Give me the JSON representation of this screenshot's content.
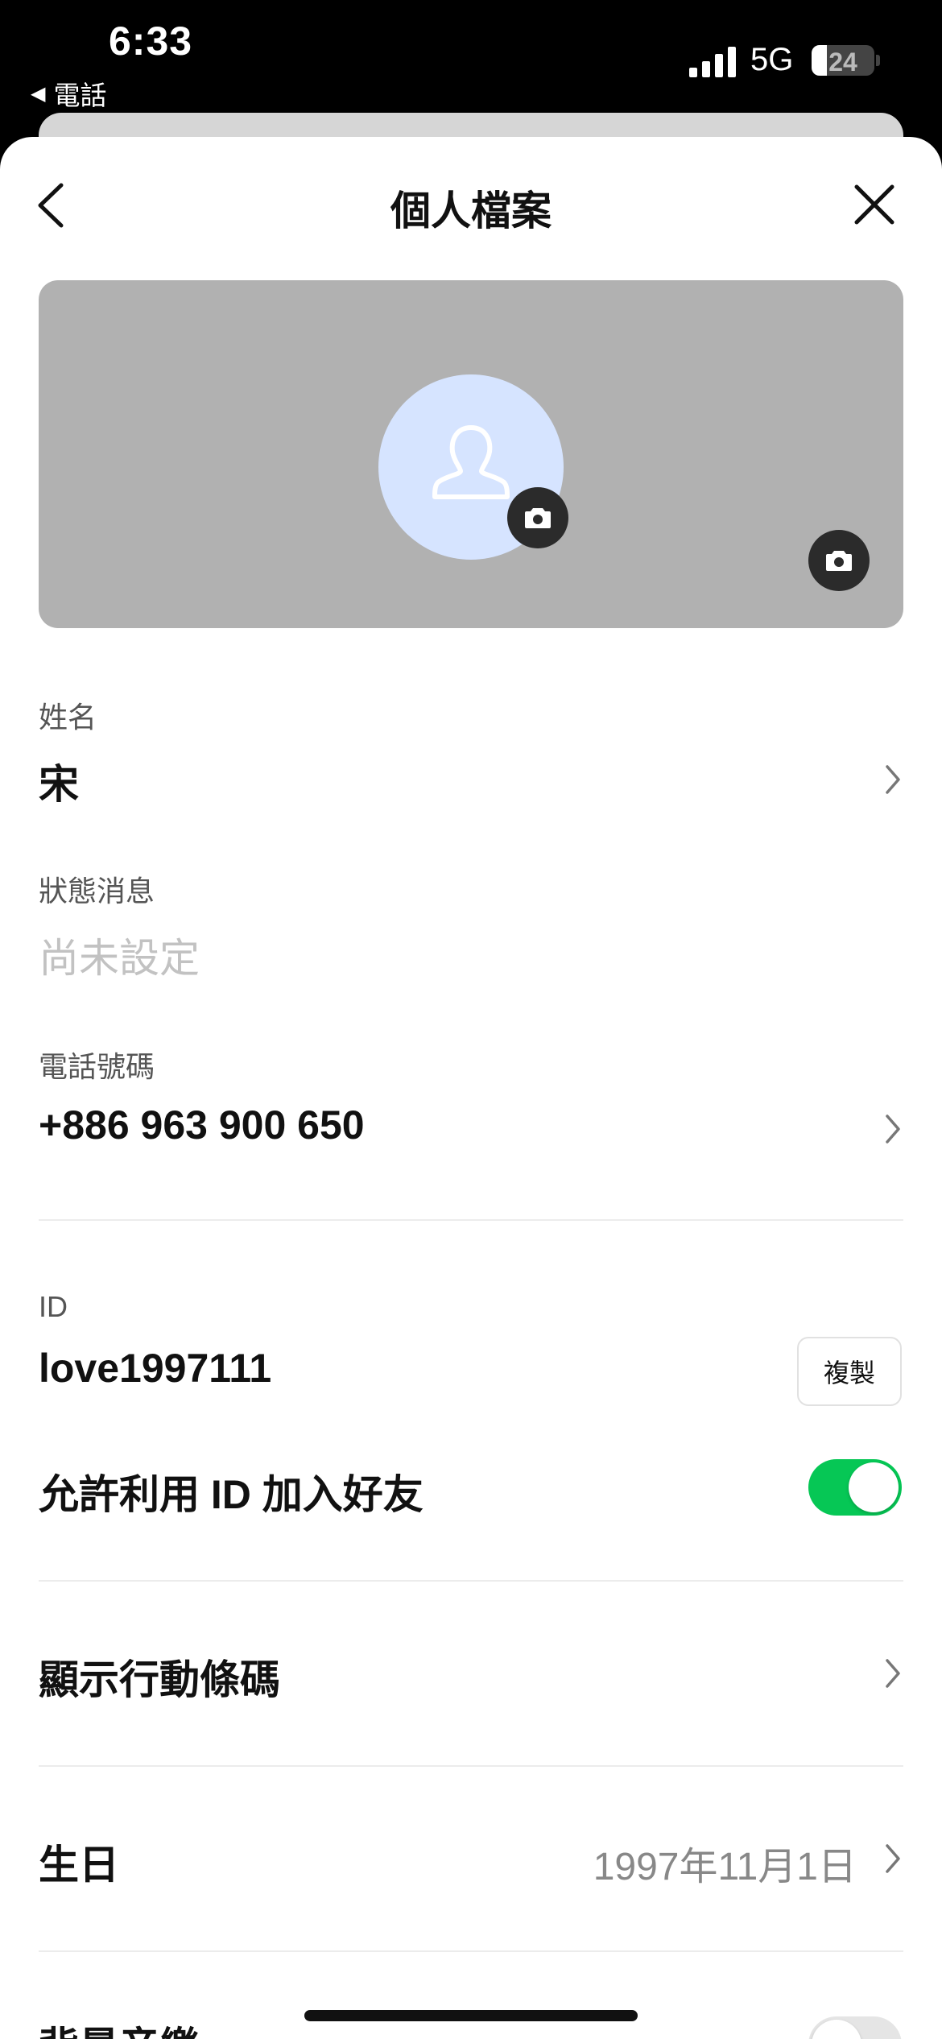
{
  "status_bar": {
    "time": "6:33",
    "back_app": "電話",
    "network": "5G",
    "battery": "24",
    "battery_level": 0.24
  },
  "nav": {
    "title": "個人檔案"
  },
  "profile": {
    "name_label": "姓名",
    "name_value": "宋",
    "status_label": "狀態消息",
    "status_value": "尚未設定",
    "phone_label": "電話號碼",
    "phone_value": "+886 963 900 650",
    "id_label": "ID",
    "id_value": "love1997111",
    "copy_label": "複製",
    "allow_id_label": "允許利用 ID 加入好友",
    "allow_id_enabled": true,
    "barcode_label": "顯示行動條碼",
    "birthday_label": "生日",
    "birthday_value": "1997年11月1日",
    "bgm_label": "背景音樂",
    "bgm_enabled": false
  },
  "colors": {
    "accent_green": "#06c755",
    "cover_gray": "#b1b1b1",
    "avatar_bg": "#d6e4ff"
  },
  "icons": {
    "back": "chevron-left-icon",
    "close": "close-icon",
    "camera": "camera-icon",
    "avatar": "person-icon",
    "row_chevron": "chevron-right-icon"
  }
}
